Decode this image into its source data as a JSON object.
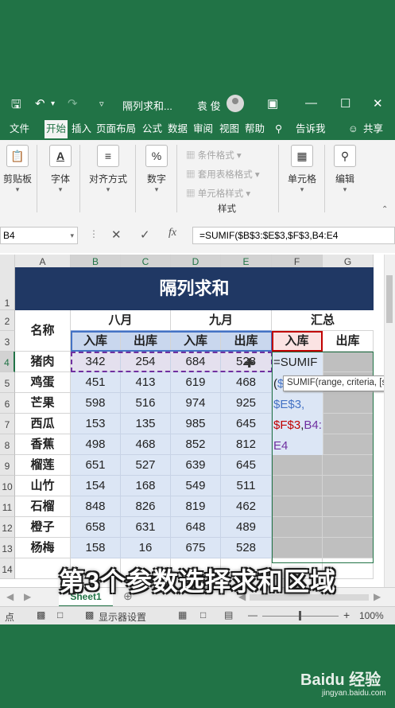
{
  "title_bar": {
    "filename": "隔列求和...",
    "user": "袁 俊"
  },
  "tabs": [
    "文件",
    "开始",
    "插入",
    "页面布局",
    "公式",
    "数据",
    "审阅",
    "视图",
    "帮助",
    "告诉我",
    "共享"
  ],
  "active_tab": "开始",
  "ribbon": {
    "clipboard": "剪贴板",
    "font": "字体",
    "align": "对齐方式",
    "number": "数字",
    "conditional": "条件格式 ▾",
    "table_format": "套用表格格式 ▾",
    "cell_style": "单元格样式 ▾",
    "styles_group": "样式",
    "cells": "单元格",
    "edit": "编辑"
  },
  "name_box": "B4",
  "formula": "=SUMIF($B$3:$E$3,$F$3,B4:E4",
  "columns": [
    "A",
    "B",
    "C",
    "D",
    "E",
    "F",
    "G"
  ],
  "rows": [
    "1",
    "2",
    "3",
    "4",
    "5",
    "6",
    "7",
    "8",
    "9",
    "10",
    "11",
    "12",
    "13",
    "14"
  ],
  "sheet": {
    "banner": "隔列求和",
    "name_header": "名称",
    "groups": [
      "八月",
      "九月",
      "汇总"
    ],
    "sub_headers": [
      "入库",
      "出库",
      "入库",
      "出库",
      "入库",
      "出库"
    ],
    "items": [
      {
        "name": "猪肉",
        "v": [
          "342",
          "254",
          "684",
          "528"
        ]
      },
      {
        "name": "鸡蛋",
        "v": [
          "451",
          "413",
          "619",
          "468"
        ]
      },
      {
        "name": "芒果",
        "v": [
          "598",
          "516",
          "974",
          "925"
        ]
      },
      {
        "name": "西瓜",
        "v": [
          "153",
          "135",
          "985",
          "645"
        ]
      },
      {
        "name": "香蕉",
        "v": [
          "498",
          "468",
          "852",
          "812"
        ]
      },
      {
        "name": "榴莲",
        "v": [
          "651",
          "527",
          "639",
          "645"
        ]
      },
      {
        "name": "山竹",
        "v": [
          "154",
          "168",
          "549",
          "511"
        ]
      },
      {
        "name": "石榴",
        "v": [
          "848",
          "826",
          "819",
          "462"
        ]
      },
      {
        "name": "橙子",
        "v": [
          "658",
          "631",
          "648",
          "489"
        ]
      },
      {
        "name": "杨梅",
        "v": [
          "158",
          "16",
          "675",
          "528"
        ]
      }
    ],
    "edit_lines": [
      "=SUMIF",
      "($",
      "$E$3,",
      "$F$3,B4:",
      "E4"
    ]
  },
  "tooltip": "SUMIF(range, criteria, [s",
  "sheet_tab": "Sheet1",
  "status": {
    "left": "点",
    "display": "显示器设置",
    "zoom": "100%"
  },
  "caption": "第3个参数选择求和区域",
  "watermark": {
    "main": "Baidu 经验",
    "sub": "jingyan.baidu.com"
  },
  "colors": {
    "excel_green": "#217346",
    "banner": "#203864",
    "range_blue": "#4472c4",
    "range_red": "#c00000",
    "range_purple": "#7030a0"
  }
}
